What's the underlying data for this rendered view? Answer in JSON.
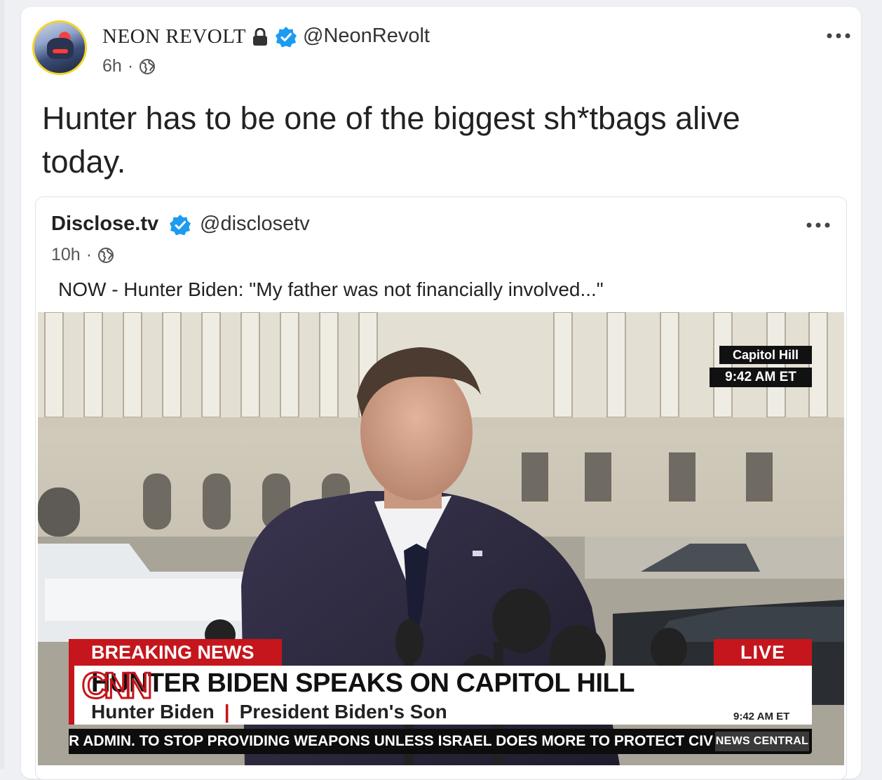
{
  "post": {
    "author_name": "NEON REVOLT",
    "handle": "@NeonRevolt",
    "time": "6h",
    "separator": "·",
    "text": "Hunter has to be one of the biggest sh*tbags alive today."
  },
  "quoted_post": {
    "author_name": "Disclose.tv",
    "handle": "@disclosetv",
    "time": "10h",
    "separator": "·",
    "text": "NOW - Hunter Biden: \"My father was not financially involved...\""
  },
  "video": {
    "location_badge": "Capitol Hill",
    "time_badge": "9:42 AM ET",
    "breaking_label": "BREAKING NEWS",
    "live_label": "LIVE",
    "headline": "HUNTER BIDEN SPEAKS ON CAPITOL HILL",
    "subject_name": "Hunter Biden",
    "subject_separator": "|",
    "subject_title": "President Biden's Son",
    "logo_text": "CNN",
    "logo_time": "9:42 AM ET",
    "ticker_text": "R ADMIN. TO STOP PROVIDING WEAPONS UNLESS ISRAEL DOES MORE TO PROTECT CIVIL",
    "ticker_tag": "NEWS CENTRAL"
  },
  "colors": {
    "verified_blue": "#1d9bf0",
    "cnn_red": "#c4161c",
    "avatar_ring": "#f3d42c"
  },
  "icons": {
    "lock": "lock-icon",
    "verified": "verified-badge-icon",
    "globe": "globe-icon",
    "more": "more-horizontal-icon"
  }
}
